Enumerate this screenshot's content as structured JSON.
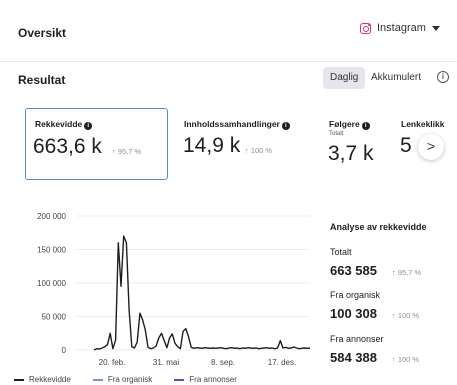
{
  "header": {
    "title": "Oversikt",
    "platform": "Instagram"
  },
  "results": {
    "title": "Resultat",
    "toggle": {
      "daily": "Daglig",
      "accumulated": "Akkumulert"
    },
    "info_glyph": "i"
  },
  "metrics": [
    {
      "label": "Rekkevidde",
      "value": "663,6 k",
      "trend": "↑ 95,7 %"
    },
    {
      "label": "Innholdssamhandlinger",
      "value": "14,9 k",
      "trend": "↑ 100 %"
    },
    {
      "label": "Følgere",
      "sublabel": "Totalt",
      "value": "3,7 k"
    },
    {
      "label": "Lenkeklikk",
      "value": "5"
    }
  ],
  "next_glyph": ">",
  "analysis": {
    "title": "Analyse av rekkevidde",
    "rows": [
      {
        "label": "Totalt",
        "value": "663 585",
        "trend": "↑ 95,7 %"
      },
      {
        "label": "Fra organisk",
        "value": "100 308",
        "trend": "↑ 100 %"
      },
      {
        "label": "Fra annonser",
        "value": "584 388",
        "trend": "↑ 100 %"
      }
    ]
  },
  "chart_data": {
    "type": "line",
    "x": [
      "20. feb.",
      "31. mai",
      "8. sep.",
      "17. des."
    ],
    "ylim": [
      0,
      200000
    ],
    "yticks": [
      "200 000",
      "150 000",
      "100 000",
      "50 000",
      "0"
    ],
    "ytick_values": [
      200000,
      150000,
      100000,
      50000,
      0
    ],
    "grid": true,
    "legend_position": "bottom",
    "series": [
      {
        "name": "Rekkevidde",
        "color": "#1c1e21",
        "values": [
          0,
          2000,
          1500,
          3000,
          5000,
          8000,
          25000,
          2000,
          15000,
          160000,
          95000,
          170000,
          160000,
          60000,
          5000,
          3000,
          12000,
          55000,
          45000,
          30000,
          4000,
          2000,
          3000,
          6000,
          18000,
          25000,
          14000,
          3500,
          18000,
          24000,
          10000,
          5000,
          2000,
          28000,
          32000,
          20000,
          4000,
          2500,
          3500,
          3000,
          2500,
          3500,
          3000,
          2500,
          3000,
          2500,
          3000,
          3500,
          2500,
          2000,
          3000,
          3500,
          2500,
          3000,
          2000,
          3000,
          2500,
          3500,
          3000,
          2500,
          3000,
          2000,
          2500,
          3000,
          3500,
          2500,
          3000,
          2000,
          3000,
          14000,
          3000,
          4000,
          2500,
          3000,
          4500,
          3000,
          2000,
          2500,
          3000,
          2500,
          3000
        ]
      },
      {
        "name": "Fra organisk",
        "color": "#7c8fe6",
        "values": []
      },
      {
        "name": "Fra annonser",
        "color": "#4b53c9",
        "values": []
      }
    ]
  }
}
